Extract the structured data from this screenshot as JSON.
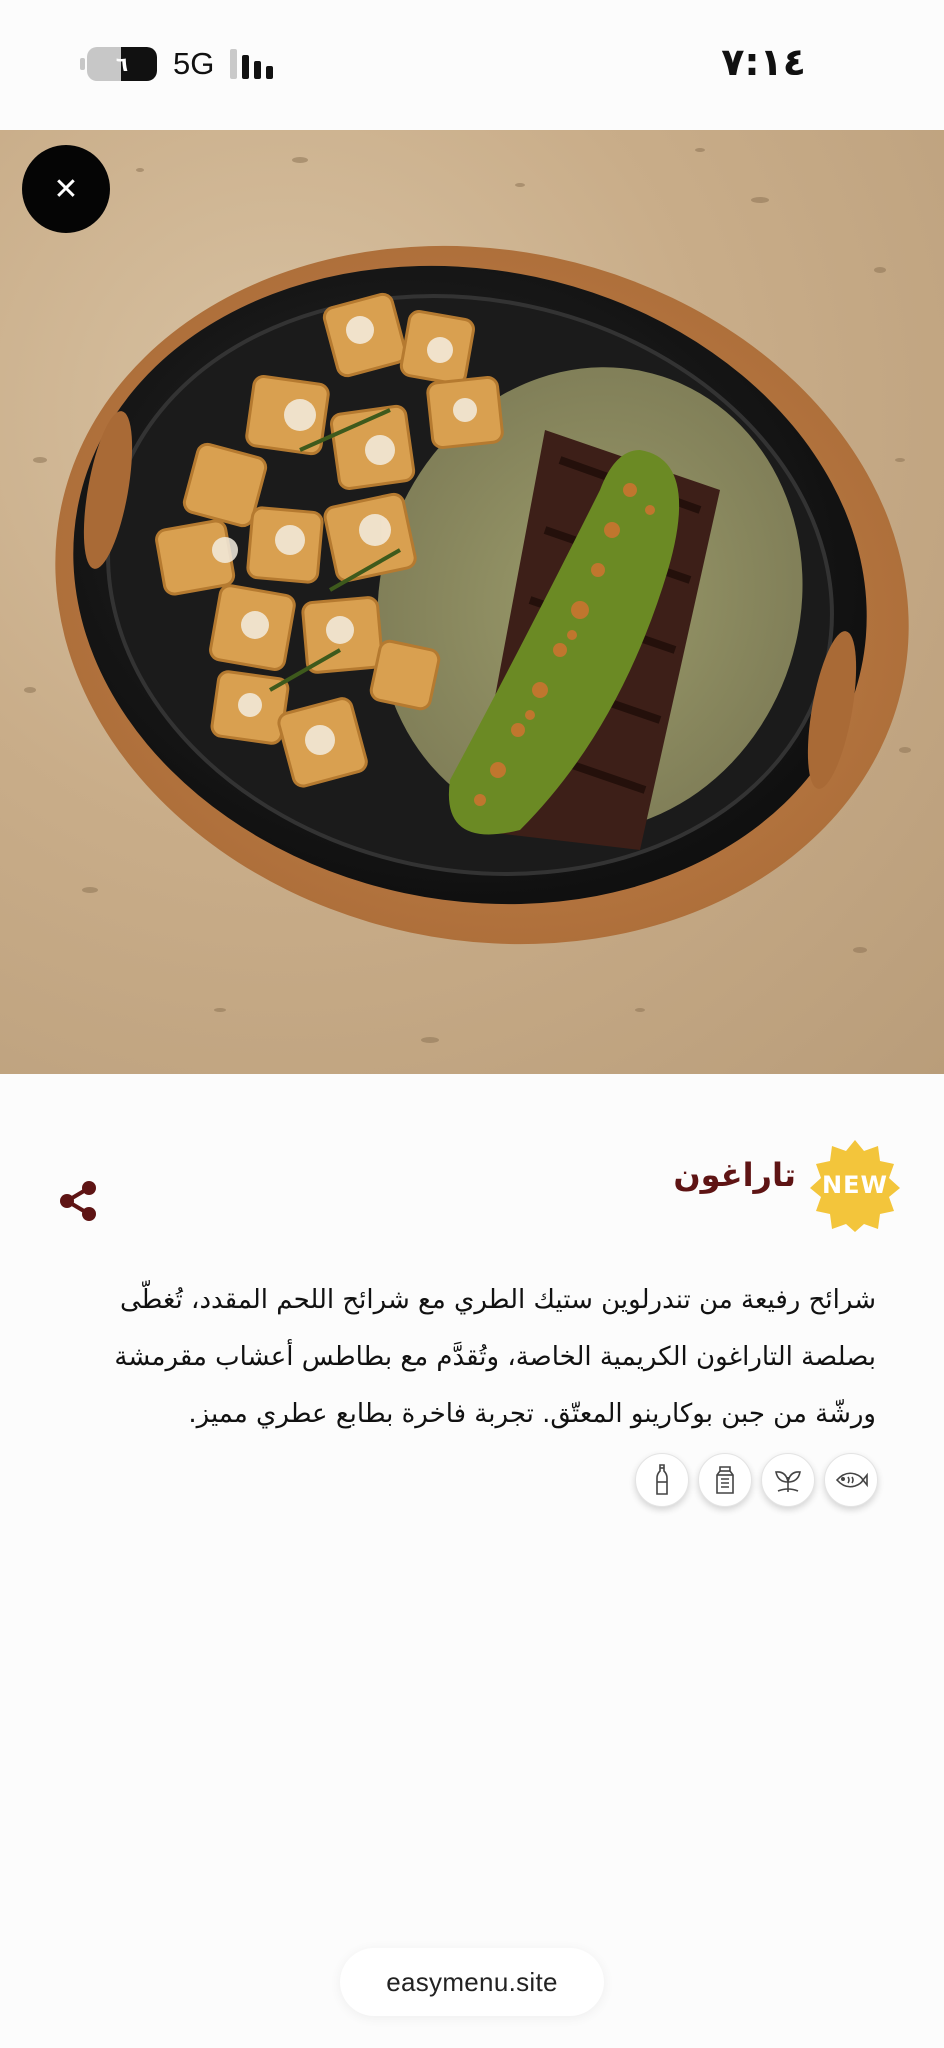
{
  "status_bar": {
    "time": "٧:١٤",
    "network": "5G",
    "battery_level": "٦"
  },
  "item": {
    "badge": "NEW",
    "title": "تاراغون",
    "description_lines": [
      "شرائح رفيعة من تندرلوين ستيك الطري مع شرائح اللحم المقدد، تُغطّى",
      "بصلصة التاراغون الكريمية الخاصة، وتُقدَّم مع بطاطس أعشاب مقرمشة",
      "ورشّة من جبن بوكارينو المعتّق. تجربة فاخرة بطابع عطري مميز."
    ],
    "attribute_icons": [
      "fish-icon",
      "leaf-icon",
      "milk-carton-icon",
      "bottle-icon"
    ]
  },
  "footer": {
    "site": "easymenu.site"
  },
  "colors": {
    "title": "#5e1414",
    "badge": "#f3c53b",
    "close_button": "#050505"
  }
}
